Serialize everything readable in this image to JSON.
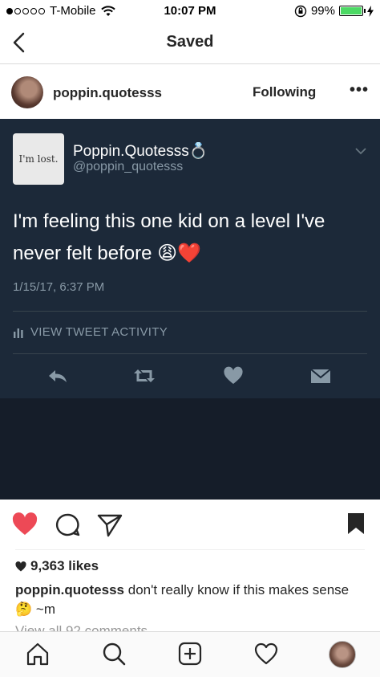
{
  "status_bar": {
    "carrier": "T-Mobile",
    "time": "10:07 PM",
    "battery": "99%",
    "signal_bars_filled": 1,
    "signal_bars_total": 5
  },
  "nav": {
    "title": "Saved",
    "back_icon": "chevron-left-icon"
  },
  "post": {
    "username": "poppin.quotesss",
    "follow_label": "Following",
    "more_label": "•••",
    "likes": "9,363 likes",
    "caption_user": "poppin.quotesss",
    "caption_text": "don't really know if this makes sense 🤔 ~m",
    "comments_link": "View all 92 comments",
    "liked": true,
    "saved": true
  },
  "tweet": {
    "avatar_text": "I'm lost.",
    "display_name": "Poppin.Quotesss💍",
    "handle": "@poppin_quotesss",
    "text": "I'm feeling this one kid on a level I've never felt before 😩❤️",
    "date": "1/15/17, 6:37 PM",
    "activity_label": "VIEW TWEET ACTIVITY"
  },
  "colors": {
    "tweet_bg": "#1c2939",
    "tweet_secondary": "#8899a6",
    "heart_red": "#ed4956",
    "battery_green": "#4cd964"
  }
}
